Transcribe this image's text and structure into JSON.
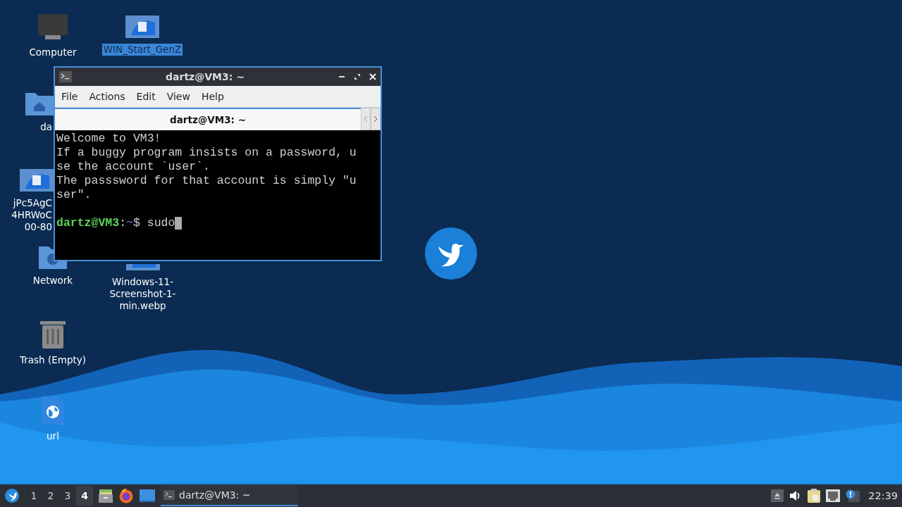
{
  "desktop": {
    "icons": [
      {
        "kind": "computer",
        "lines": [
          "Computer"
        ],
        "selected": false
      },
      {
        "kind": "image",
        "lines": [
          "WIN_Start_GenZ"
        ],
        "selected": true
      },
      {
        "kind": "home",
        "lines": [
          "da"
        ],
        "selected": false
      },
      {
        "kind": "image",
        "lines": [
          "jPc5AgC",
          "4HRWoC",
          "00-80"
        ],
        "selected": false
      },
      {
        "kind": "network",
        "lines": [
          "Network"
        ],
        "selected": false
      },
      {
        "kind": "image",
        "lines": [
          "Windows-11-",
          "Screenshot-1-",
          "min.webp"
        ],
        "selected": false
      },
      {
        "kind": "trash",
        "lines": [
          "Trash (Empty)"
        ],
        "selected": false
      },
      {
        "kind": "link",
        "lines": [
          "url"
        ],
        "selected": false
      }
    ]
  },
  "terminal_window": {
    "title": "dartz@VM3: ~",
    "menu": [
      "File",
      "Actions",
      "Edit",
      "View",
      "Help"
    ],
    "tabs": [
      {
        "label": "dartz@VM3: ~",
        "selected": true
      }
    ],
    "lines": [
      {
        "kind": "output",
        "text": "Welcome to VM3!"
      },
      {
        "kind": "output",
        "text": "If a buggy program insists on a password, u"
      },
      {
        "kind": "output",
        "text": "se the account `user`."
      },
      {
        "kind": "output",
        "text": "The passsword for that account is simply \"u"
      },
      {
        "kind": "output",
        "text": "ser\"."
      },
      {
        "kind": "blank"
      },
      {
        "kind": "prompt",
        "user_host": "dartz@VM3",
        "separator": ":",
        "path": "~",
        "symbol": "$",
        "command": "sudo",
        "cursor": true
      }
    ]
  },
  "taskbar": {
    "workspaces": [
      {
        "label": "1",
        "selected": false
      },
      {
        "label": "2",
        "selected": false
      },
      {
        "label": "3",
        "selected": false
      },
      {
        "label": "4",
        "selected": true
      }
    ],
    "tasks": [
      {
        "title": "dartz@VM3: ~",
        "active": true
      }
    ],
    "clock": "22:39"
  }
}
